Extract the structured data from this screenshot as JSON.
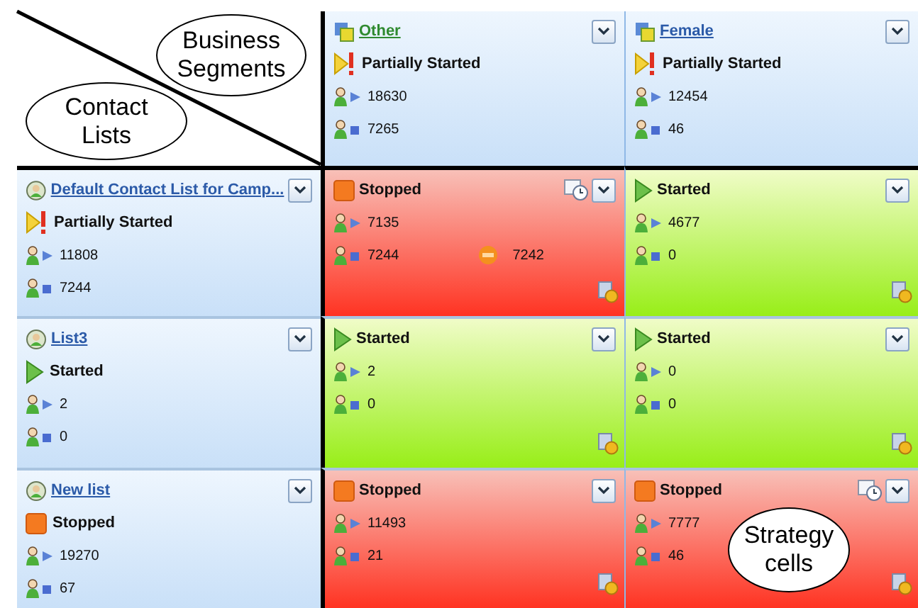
{
  "callouts": [
    {
      "kind": "segments",
      "text": "Business Segments"
    },
    {
      "kind": "lists",
      "text": "Contact Lists"
    },
    {
      "kind": "cells",
      "text": "Strategy cells"
    }
  ],
  "segments": [
    {
      "name": "Other",
      "visited": true,
      "kind": "partial",
      "status_text": "Partially Started",
      "sent": "18630",
      "stopped": "7265"
    },
    {
      "name": "Female",
      "visited": false,
      "kind": "partial",
      "status_text": "Partially Started",
      "sent": "12454",
      "stopped": "46"
    }
  ],
  "rows": [
    {
      "list": {
        "name": "Default Contact List for Camp...",
        "kind": "partial",
        "status_text": "Partially Started",
        "sent": "11808",
        "stopped": "7244"
      },
      "cells": [
        {
          "kind": "stopped",
          "status_text": "Stopped",
          "sent": "7135",
          "stopped": "7244",
          "excluded": "7242",
          "schedule": true
        },
        {
          "kind": "started",
          "status_text": "Started",
          "sent": "4677",
          "stopped": "0",
          "schedule": false
        }
      ]
    },
    {
      "list": {
        "name": "List3",
        "kind": "started",
        "status_text": "Started",
        "sent": "2",
        "stopped": "0"
      },
      "cells": [
        {
          "kind": "started",
          "status_text": "Started",
          "sent": "2",
          "stopped": "0",
          "schedule": false
        },
        {
          "kind": "started",
          "status_text": "Started",
          "sent": "0",
          "stopped": "0",
          "schedule": false
        }
      ]
    },
    {
      "list": {
        "name": "New list",
        "kind": "stopped",
        "status_text": "Stopped",
        "sent": "19270",
        "stopped": "67"
      },
      "cells": [
        {
          "kind": "stopped",
          "status_text": "Stopped",
          "sent": "11493",
          "stopped": "21",
          "schedule": false
        },
        {
          "kind": "stopped",
          "status_text": "Stopped",
          "sent": "7777",
          "stopped": "46",
          "schedule": true
        }
      ]
    }
  ]
}
